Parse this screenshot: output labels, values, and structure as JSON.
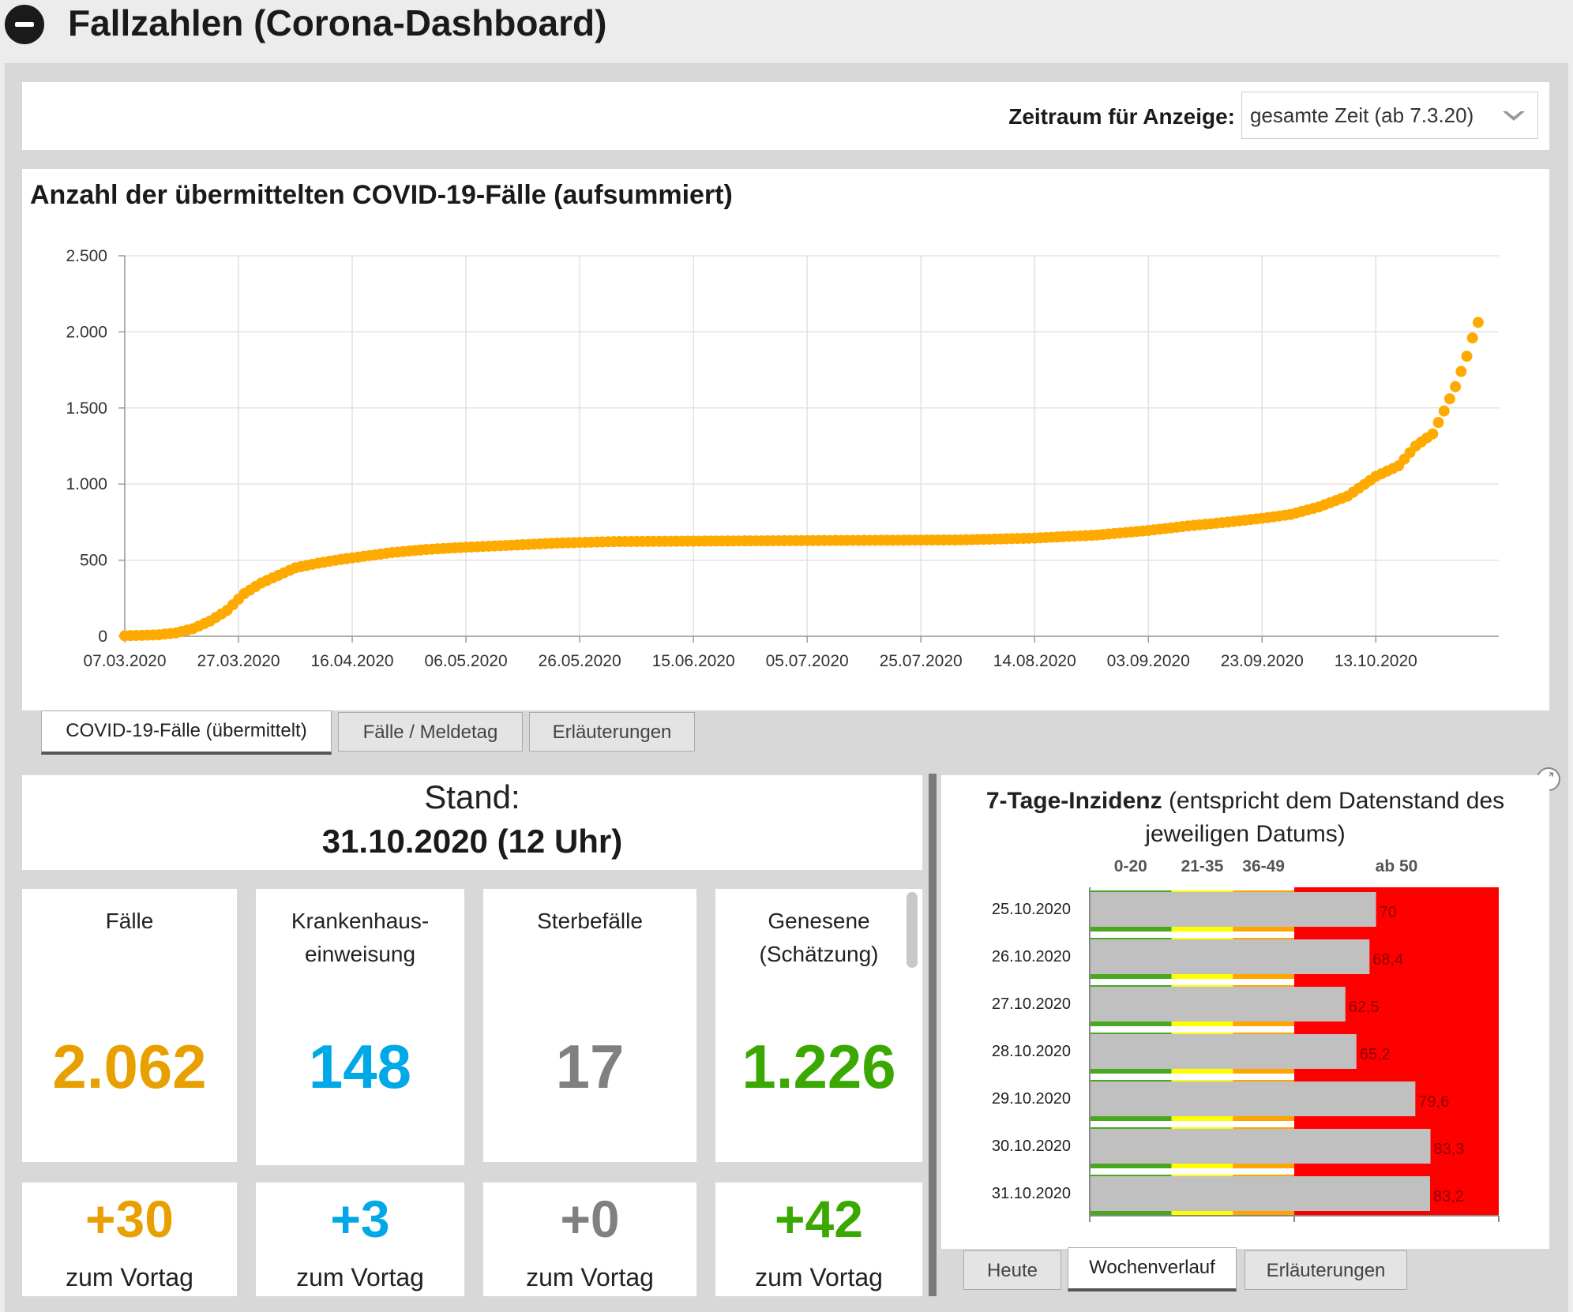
{
  "header": {
    "title": "Fallzahlen (Corona-Dashboard)"
  },
  "filter": {
    "label": "Zeitraum für Anzeige:",
    "value": "gesamte Zeit (ab 7.3.20)"
  },
  "chart_data": {
    "type": "scatter",
    "title": "Anzahl der übermittelten COVID-19-Fälle (aufsummiert)",
    "xlabel": "",
    "ylabel": "",
    "ylim": [
      0,
      2500
    ],
    "xlim": [
      "07.03.2020",
      "31.10.2020"
    ],
    "ytick_labels": [
      "0",
      "500",
      "1.000",
      "1.500",
      "2.000",
      "2.500"
    ],
    "xtick_labels": [
      "07.03.2020",
      "27.03.2020",
      "16.04.2020",
      "06.05.2020",
      "26.05.2020",
      "15.06.2020",
      "05.07.2020",
      "25.07.2020",
      "14.08.2020",
      "03.09.2020",
      "23.09.2020",
      "13.10.2020"
    ],
    "grid": true,
    "color": "#ffaa00",
    "points": [
      {
        "x": "07.03.2020",
        "y": 3
      },
      {
        "x": "10.03.2020",
        "y": 6
      },
      {
        "x": "13.03.2020",
        "y": 10
      },
      {
        "x": "16.03.2020",
        "y": 22
      },
      {
        "x": "19.03.2020",
        "y": 50
      },
      {
        "x": "22.03.2020",
        "y": 100
      },
      {
        "x": "25.03.2020",
        "y": 170
      },
      {
        "x": "28.03.2020",
        "y": 280
      },
      {
        "x": "31.03.2020",
        "y": 350
      },
      {
        "x": "03.04.2020",
        "y": 400
      },
      {
        "x": "06.04.2020",
        "y": 450
      },
      {
        "x": "10.04.2020",
        "y": 480
      },
      {
        "x": "14.04.2020",
        "y": 505
      },
      {
        "x": "18.04.2020",
        "y": 525
      },
      {
        "x": "23.04.2020",
        "y": 550
      },
      {
        "x": "29.04.2020",
        "y": 570
      },
      {
        "x": "06.05.2020",
        "y": 585
      },
      {
        "x": "14.05.2020",
        "y": 598
      },
      {
        "x": "22.05.2020",
        "y": 612
      },
      {
        "x": "01.06.2020",
        "y": 622
      },
      {
        "x": "15.06.2020",
        "y": 625
      },
      {
        "x": "01.07.2020",
        "y": 628
      },
      {
        "x": "15.07.2020",
        "y": 630
      },
      {
        "x": "01.08.2020",
        "y": 633
      },
      {
        "x": "14.08.2020",
        "y": 645
      },
      {
        "x": "25.08.2020",
        "y": 665
      },
      {
        "x": "03.09.2020",
        "y": 695
      },
      {
        "x": "10.09.2020",
        "y": 725
      },
      {
        "x": "17.09.2020",
        "y": 750
      },
      {
        "x": "23.09.2020",
        "y": 775
      },
      {
        "x": "28.09.2020",
        "y": 800
      },
      {
        "x": "03.10.2020",
        "y": 850
      },
      {
        "x": "08.10.2020",
        "y": 920
      },
      {
        "x": "13.10.2020",
        "y": 1050
      },
      {
        "x": "17.10.2020",
        "y": 1120
      },
      {
        "x": "20.10.2020",
        "y": 1250
      },
      {
        "x": "23.10.2020",
        "y": 1330
      },
      {
        "x": "25.10.2020",
        "y": 1480
      },
      {
        "x": "27.10.2020",
        "y": 1640
      },
      {
        "x": "29.10.2020",
        "y": 1840
      },
      {
        "x": "30.10.2020",
        "y": 1960
      },
      {
        "x": "31.10.2020",
        "y": 2062
      }
    ]
  },
  "tabs_top": [
    {
      "label": "COVID-19-Fälle (übermittelt)",
      "active": true
    },
    {
      "label": "Fälle / Meldetag",
      "active": false
    },
    {
      "label": "Erläuterungen",
      "active": false
    }
  ],
  "stand": {
    "label": "Stand:",
    "date": "31.10.2020 (12 Uhr)"
  },
  "cards": [
    {
      "title": "Fälle",
      "value": "2.062",
      "delta": "+30",
      "delta_label": "zum Vortag",
      "color": "#e8a000"
    },
    {
      "title": "Krankenhaus-\neinweisung",
      "value": "148",
      "delta": "+3",
      "delta_label": "zum Vortag",
      "color": "#00a8e8"
    },
    {
      "title": "Sterbefälle",
      "value": "17",
      "delta": "+0",
      "delta_label": "zum Vortag",
      "color": "#808080"
    },
    {
      "title": "Genesene\n(Schätzung)",
      "value": "1.226",
      "delta": "+42",
      "delta_label": "zum Vortag",
      "color": "#3aa800"
    }
  ],
  "incidence": {
    "title_bold": "7-Tage-Inzidenz",
    "title_rest": " (entspricht dem Datenstand des jeweiligen Datums)",
    "bands": [
      {
        "label": "0-20",
        "from": 0,
        "to": 20,
        "color": "#4aa820"
      },
      {
        "label": "21-35",
        "from": 20,
        "to": 35,
        "color": "#ffff00"
      },
      {
        "label": "36-49",
        "from": 35,
        "to": 50,
        "color": "#ffa500"
      },
      {
        "label": "ab 50",
        "from": 50,
        "to": 100,
        "color": "#ff0000"
      }
    ],
    "chart_data": {
      "type": "bar",
      "orientation": "horizontal",
      "xlim": [
        0,
        100
      ],
      "categories": [
        "25.10.2020",
        "26.10.2020",
        "27.10.2020",
        "28.10.2020",
        "29.10.2020",
        "30.10.2020",
        "31.10.2020"
      ],
      "values": [
        70,
        68.4,
        62.5,
        65.2,
        79.6,
        83.3,
        83.2
      ],
      "value_labels": [
        "70",
        "68,4",
        "62,5",
        "65,2",
        "79,6",
        "83,3",
        "83,2"
      ],
      "bar_color": "#c0c0c0"
    }
  },
  "tabs_bottom": [
    {
      "label": "Heute",
      "active": false
    },
    {
      "label": "Wochenverlauf",
      "active": true
    },
    {
      "label": "Erläuterungen",
      "active": false
    }
  ]
}
